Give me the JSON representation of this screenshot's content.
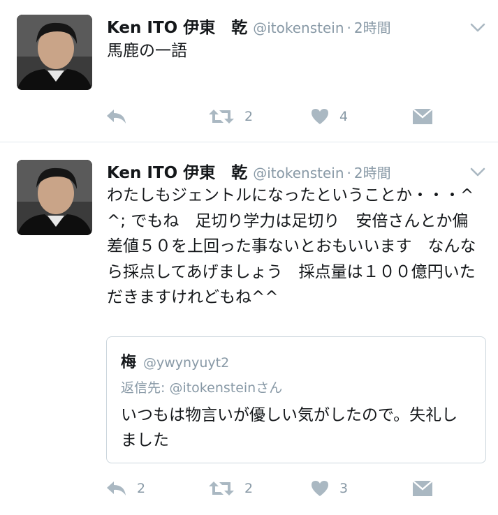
{
  "tweets": [
    {
      "author_name": "Ken ITO 伊東　乾",
      "handle": "@itokenstein",
      "separator": "·",
      "time": "2時間",
      "text": "馬鹿の一語",
      "actions": {
        "reply_count": "",
        "retweet_count": "2",
        "like_count": "4"
      }
    },
    {
      "author_name": "Ken ITO 伊東　乾",
      "handle": "@itokenstein",
      "separator": "·",
      "time": "2時間",
      "text": "わたしもジェントルになったということか・・・^^; でもね　足切り学力は足切り　安倍さんとか偏差値５０を上回った事ないとおもいいます　なんなら採点してあげましょう　採点量は１００億円いただきますけれどもね^^",
      "quoted": {
        "author_name": "梅",
        "handle": "@ywynyuyt2",
        "reply_prefix": "返信先: ",
        "reply_to": "@itokenstein",
        "reply_suffix": "さん",
        "text": "いつもは物言いが優しい気がしたので。失礼しました"
      },
      "actions": {
        "reply_count": "2",
        "retweet_count": "2",
        "like_count": "3"
      }
    }
  ],
  "icons": [
    "reply-icon",
    "retweet-icon",
    "heart-icon",
    "direct-message-icon",
    "chevron-down-icon"
  ],
  "colors": {
    "text": "#14171a",
    "secondary": "#8899a6",
    "icon": "#aab8c2",
    "border": "#e1e8ed"
  }
}
